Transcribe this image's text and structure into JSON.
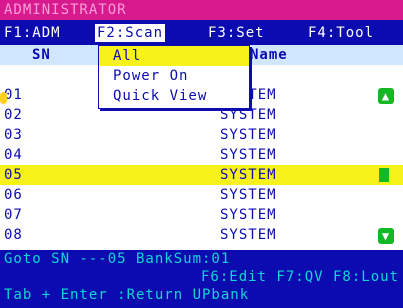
{
  "title": "ADMINISTRATOR",
  "menu": {
    "items": [
      {
        "label": "F1:ADM"
      },
      {
        "label": "F2:Scan"
      },
      {
        "label": "F3:Set"
      },
      {
        "label": "F4:Tool"
      }
    ]
  },
  "list_header": {
    "sn_label": "SN",
    "name_label": "Name"
  },
  "dropdown": {
    "items": [
      {
        "label": "All"
      },
      {
        "label": "Power On"
      },
      {
        "label": "Quick View"
      }
    ]
  },
  "list": {
    "rows": [
      {
        "sn": "01",
        "name": "SYSTEM"
      },
      {
        "sn": "02",
        "name": "SYSTEM"
      },
      {
        "sn": "03",
        "name": "SYSTEM"
      },
      {
        "sn": "04",
        "name": "SYSTEM"
      },
      {
        "sn": "05",
        "name": "SYSTEM"
      },
      {
        "sn": "06",
        "name": "SYSTEM"
      },
      {
        "sn": "07",
        "name": "SYSTEM"
      },
      {
        "sn": "08",
        "name": "SYSTEM"
      }
    ]
  },
  "status": {
    "line1": "Goto SN ---05      BankSum:01",
    "line2": "F6:Edit F7:QV  F8:Lout",
    "line3": "Tab + Enter :Return UPbank"
  },
  "icons": {
    "scroll_up": "scroll-up-icon",
    "scroll_down": "scroll-down-icon",
    "cursor": "cursor-marker-icon"
  },
  "colors": {
    "background": "#0b0bb0",
    "title_bar": "#d81a8f",
    "title_text": "#ff9ed6",
    "menu_text": "#ffffff",
    "list_bg": "#ffffff",
    "list_text": "#0b0bb0",
    "header_bg": "#cfe7ff",
    "highlight": "#f7f31a",
    "status_text": "#12d6d1",
    "accent_green": "#13b825",
    "cursor": "#ffd11a"
  }
}
